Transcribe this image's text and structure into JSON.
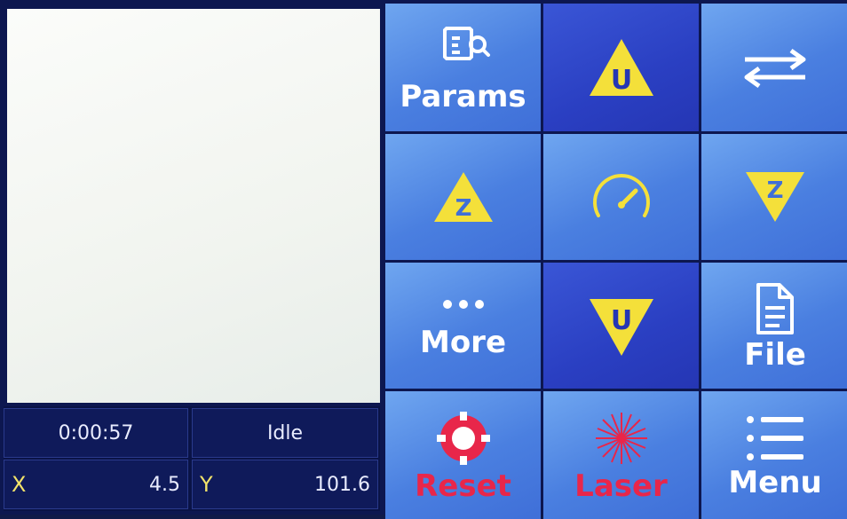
{
  "status": {
    "elapsed": "0:00:57",
    "state": "Idle",
    "x_label": "X",
    "x_value": "4.5",
    "y_label": "Y",
    "y_value": "101.6"
  },
  "tiles": {
    "params": "Params",
    "more": "More",
    "file": "File",
    "reset": "Reset",
    "laser": "Laser",
    "menu": "Menu",
    "u_letter": "U",
    "z_letter": "Z"
  },
  "colors": {
    "tile_light": "#4a7fe0",
    "tile_dark": "#2a3fc2",
    "warning_yellow": "#f4e03a",
    "reset_red": "#e8264a"
  },
  "icons": [
    "params-search-icon",
    "u-up-icon",
    "swap-arrows-icon",
    "z-up-icon",
    "speed-gauge-icon",
    "z-down-icon",
    "more-dots-icon",
    "u-down-icon",
    "file-icon",
    "reset-target-icon",
    "laser-icon",
    "menu-list-icon"
  ]
}
